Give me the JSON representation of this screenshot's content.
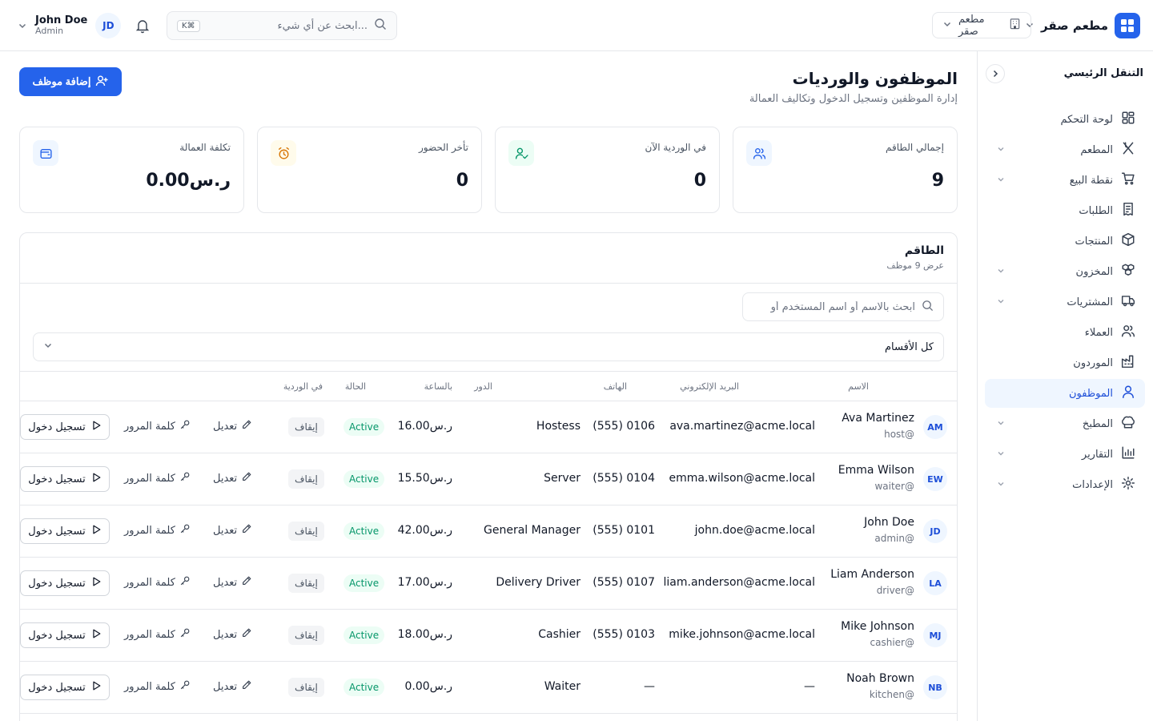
{
  "header": {
    "brand_name": "مطعم صقر",
    "branch": "مطعم صقر",
    "search_placeholder": "ابحث عن أي شيء...",
    "search_shortcut": "K⌘",
    "user_name": "John Doe",
    "user_role": "Admin",
    "user_initials": "JD"
  },
  "sidebar": {
    "title": "التنقل الرئيسي",
    "items": [
      {
        "label": "لوحة التحكم",
        "icon": "dashboard-icon",
        "expandable": false
      },
      {
        "label": "المطعم",
        "icon": "utensils-icon",
        "expandable": true
      },
      {
        "label": "نقطة البيع",
        "icon": "cart-icon",
        "expandable": true
      },
      {
        "label": "الطلبات",
        "icon": "receipt-icon",
        "expandable": false
      },
      {
        "label": "المنتجات",
        "icon": "box-icon",
        "expandable": false
      },
      {
        "label": "المخزون",
        "icon": "boxes-icon",
        "expandable": true
      },
      {
        "label": "المشتريات",
        "icon": "truck-icon",
        "expandable": true
      },
      {
        "label": "العملاء",
        "icon": "users-icon",
        "expandable": false
      },
      {
        "label": "الموردون",
        "icon": "factory-icon",
        "expandable": false
      },
      {
        "label": "الموظفون",
        "icon": "user-icon",
        "expandable": false,
        "active": true
      },
      {
        "label": "المطبخ",
        "icon": "chef-hat-icon",
        "expandable": true
      },
      {
        "label": "التقارير",
        "icon": "chart-icon",
        "expandable": true
      },
      {
        "label": "الإعدادات",
        "icon": "gear-icon",
        "expandable": true
      }
    ]
  },
  "page": {
    "title": "الموظفون والورديات",
    "subtitle": "إدارة الموظفين وتسجيل الدخول وتكاليف العمالة",
    "add_button": "إضافة موظف"
  },
  "stats": [
    {
      "label": "إجمالي الطاقم",
      "value": "9",
      "icon": "users-icon",
      "color": "#2563eb",
      "bg": "#eff6ff"
    },
    {
      "label": "في الوردية الآن",
      "value": "0",
      "icon": "user-check-icon",
      "color": "#059669",
      "bg": "#ecfdf5"
    },
    {
      "label": "تأخر الحضور",
      "value": "0",
      "icon": "alarm-clock-icon",
      "color": "#d97706",
      "bg": "#fffbeb"
    },
    {
      "label": "تكلفة العمالة",
      "value": "ر.س0.00",
      "icon": "wallet-icon",
      "color": "#2563eb",
      "bg": "#eff6ff"
    }
  ],
  "staff_panel": {
    "title": "الطاقم",
    "subtitle": "عرض 9 موظف",
    "search_placeholder": "ابحث بالاسم أو اسم المستخدم أو",
    "department_select": "كل الأقسام",
    "columns": {
      "name": "الاسم",
      "email": "البريد الإلكتروني",
      "phone": "الهاتف",
      "role": "الدور",
      "rate": "بالساعة",
      "status": "الحالة",
      "shift": "في الوردية"
    },
    "actions": {
      "edit": "تعديل",
      "password": "كلمة المرور",
      "clock_in": "تسجيل دخول"
    },
    "rows": [
      {
        "initials": "AM",
        "name": "Ava Martinez",
        "username": "host@",
        "email": "ava.martinez@acme.local",
        "phone": "(555) 0106",
        "role": "Hostess",
        "rate": "ر.س16.00",
        "status": "Active",
        "shift": "إيقاف"
      },
      {
        "initials": "EW",
        "name": "Emma Wilson",
        "username": "waiter@",
        "email": "emma.wilson@acme.local",
        "phone": "(555) 0104",
        "role": "Server",
        "rate": "ر.س15.50",
        "status": "Active",
        "shift": "إيقاف"
      },
      {
        "initials": "JD",
        "name": "John Doe",
        "username": "admin@",
        "email": "john.doe@acme.local",
        "phone": "(555) 0101",
        "role": "General Manager",
        "rate": "ر.س42.00",
        "status": "Active",
        "shift": "إيقاف"
      },
      {
        "initials": "LA",
        "name": "Liam Anderson",
        "username": "driver@",
        "email": "liam.anderson@acme.local",
        "phone": "(555) 0107",
        "role": "Delivery Driver",
        "rate": "ر.س17.00",
        "status": "Active",
        "shift": "إيقاف"
      },
      {
        "initials": "MJ",
        "name": "Mike Johnson",
        "username": "cashier@",
        "email": "mike.johnson@acme.local",
        "phone": "(555) 0103",
        "role": "Cashier",
        "rate": "ر.س18.00",
        "status": "Active",
        "shift": "إيقاف"
      },
      {
        "initials": "NB",
        "name": "Noah Brown",
        "username": "kitchen@",
        "email": "—",
        "phone": "—",
        "role": "Waiter",
        "rate": "ر.س0.00",
        "status": "Active",
        "shift": "إيقاف"
      }
    ]
  }
}
